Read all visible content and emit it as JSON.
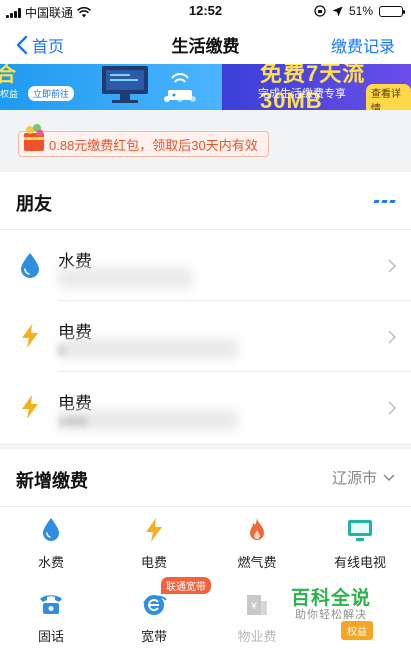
{
  "status_bar": {
    "carrier": "中国联通",
    "time": "12:52",
    "battery": "51%",
    "battery_level": 0.51
  },
  "nav": {
    "back_label": "首页",
    "title": "生活缴费",
    "record_label": "缴费记录"
  },
  "banner": {
    "left_big": "合",
    "left_small": "权益",
    "left_button": "立即前往",
    "right_big": "免费7天流30MB",
    "right_small": "完成生活缴费专享",
    "right_button": "查看详情"
  },
  "coupon": {
    "text": "0.88元缴费红包，领取后30天内有效"
  },
  "friends": {
    "title": "朋友",
    "items": [
      {
        "type": "water",
        "name": "水费",
        "sub": ""
      },
      {
        "type": "electric",
        "name": "电费",
        "sub": "0"
      },
      {
        "type": "electric",
        "name": "电费",
        "sub": "1495"
      }
    ]
  },
  "new_payment": {
    "title": "新增缴费",
    "region": "辽源市",
    "items": [
      {
        "label": "水费",
        "icon": "water-drop-icon",
        "enabled": true
      },
      {
        "label": "电费",
        "icon": "lightning-icon",
        "enabled": true
      },
      {
        "label": "燃气费",
        "icon": "flame-icon",
        "enabled": true
      },
      {
        "label": "有线电视",
        "icon": "tv-icon",
        "enabled": true
      },
      {
        "label": "固话",
        "icon": "telephone-icon",
        "enabled": true
      },
      {
        "label": "宽带",
        "icon": "broadband-icon",
        "enabled": true,
        "tag": "联通宽带"
      },
      {
        "label": "物业费",
        "icon": "building-icon",
        "enabled": false
      }
    ]
  },
  "watermark": {
    "title": "百科全说",
    "subtitle": "助你轻松解决",
    "badge": "权益"
  },
  "colors": {
    "accent": "#1677ff",
    "water": "#2f8ee0",
    "electric": "#f5b01d",
    "gas": "#f06a35",
    "tv": "#1fb5a3",
    "coupon": "#e4542b"
  }
}
